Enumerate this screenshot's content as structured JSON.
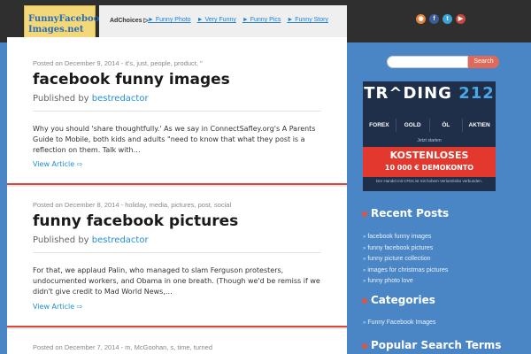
{
  "site": {
    "logo_title": "FunnyFacebook Images.net"
  },
  "adbar": {
    "adchoices": "AdChoices ▷",
    "links": [
      "► Funny Photo",
      "► Very Funny",
      "► Funny Pics",
      "► Funny Story"
    ]
  },
  "social_icons": [
    "rss-icon",
    "facebook-icon",
    "twitter-icon",
    "youtube-icon"
  ],
  "posts": [
    {
      "meta": "Posted on December 9, 2014 - it's, just, people, product, \"",
      "title": "facebook funny images",
      "published_by": "Published by",
      "author": "bestredactor",
      "excerpt": "Why you should 'share thoughtfully.' As we say in ConnectSafley.org's A Parents Guide to Mobile, both kids and adults \"need to know that what they post is a reflection on them. Talk with…",
      "read_more": "View Article ⇨"
    },
    {
      "meta": "Posted on December 8, 2014 - holiday, media, pictures, post, social",
      "title": "funny facebook pictures",
      "published_by": "Published by",
      "author": "bestredactor",
      "excerpt": "For that, we applaud Palin, who managed to slam Ferguson protesters, undocumented workers, and Obama in one breath. (Though we'd be remiss if we didn't give credit to Mad World News,…",
      "read_more": "View Article ⇨"
    },
    {
      "meta": "Posted on December 7, 2014 - m, McGoohan, s, time, turned"
    }
  ],
  "sidebar": {
    "search_button": "Search",
    "search_placeholder": "",
    "ad": {
      "brand_prefix": "TR^DING",
      "brand_number": "212",
      "categories": [
        "FOREX",
        "GOLD",
        "ÖL",
        "AKTIEN"
      ],
      "small": "Jetzt starten",
      "cta_line1": "KOSTENLOSES",
      "cta_line2": "10 000 € DEMOKONTO",
      "footer": "Der Handel mit CFDs ist mit hohem Verlustrisiko verbunden."
    },
    "recent_posts_title": "Recent Posts",
    "recent_posts": [
      "facebook funny images",
      "funny facebook pictures",
      "funny picture collection",
      "images for christmas pictures",
      "funny photo love"
    ],
    "categories_title": "Categories",
    "categories": [
      "Funny Facebook Images"
    ],
    "popular_title": "Popular Search Terms"
  },
  "colors": {
    "accent_red": "#d9473a",
    "link_blue": "#1e8fd6",
    "sidebar_blue": "#4a86c5",
    "logo_yellow": "#f3d87a"
  }
}
